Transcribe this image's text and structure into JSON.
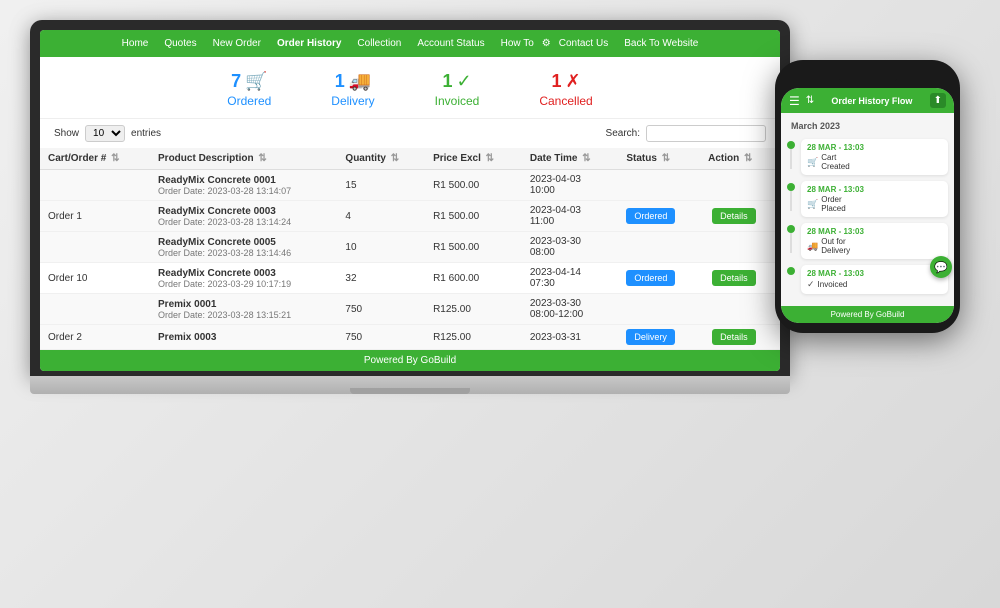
{
  "nav": {
    "items": [
      {
        "label": "Home",
        "active": false
      },
      {
        "label": "Quotes",
        "active": false
      },
      {
        "label": "New Order",
        "active": false
      },
      {
        "label": "Order History",
        "active": true
      },
      {
        "label": "Collection",
        "active": false
      },
      {
        "label": "Account Status",
        "active": false
      },
      {
        "label": "How To",
        "active": false
      },
      {
        "label": "Contact Us",
        "active": false
      },
      {
        "label": "Back To Website",
        "active": false
      }
    ]
  },
  "stats": {
    "ordered": {
      "count": "7",
      "label": "Ordered",
      "icon": "🛒"
    },
    "delivery": {
      "count": "1",
      "label": "Delivery",
      "icon": "🚚"
    },
    "invoiced": {
      "count": "1",
      "label": "Invoiced",
      "icon": "✓"
    },
    "cancelled": {
      "count": "1",
      "label": "Cancelled",
      "icon": "✗"
    }
  },
  "table_controls": {
    "show_label": "Show",
    "show_value": "10",
    "entries_label": "entries",
    "search_label": "Search:"
  },
  "table": {
    "columns": [
      "Cart/Order #",
      "Product Description",
      "Quantity",
      "Price Excl",
      "Date Time",
      "Status",
      "Action"
    ],
    "rows": [
      {
        "order": "Order 1",
        "product": "ReadyMix Concrete 0001",
        "order_date": "Order Date: 2023-03-28 13:14:07",
        "quantity": "15",
        "price": "R1 500.00",
        "datetime": "2023-04-03\n10:00",
        "status": "",
        "action": ""
      },
      {
        "order": "Order 1",
        "product": "ReadyMix Concrete 0003",
        "order_date": "Order Date: 2023-03-28 13:14:24",
        "quantity": "4",
        "price": "R1 500.00",
        "datetime": "2023-04-03\n11:00",
        "status": "Ordered",
        "action": "Details"
      },
      {
        "order": "Order 1",
        "product": "ReadyMix Concrete 0005",
        "order_date": "Order Date: 2023-03-28 13:14:46",
        "quantity": "10",
        "price": "R1 500.00",
        "datetime": "2023-03-30\n08:00",
        "status": "",
        "action": ""
      },
      {
        "order": "Order 10",
        "product": "ReadyMix Concrete 0003",
        "order_date": "Order Date: 2023-03-29 10:17:19",
        "quantity": "32",
        "price": "R1 600.00",
        "datetime": "2023-04-14\n07:30",
        "status": "Ordered",
        "action": "Details"
      },
      {
        "order": "Order 2",
        "product": "Premix 0001",
        "order_date": "Order Date: 2023-03-28 13:15:21",
        "quantity": "750",
        "price": "R125.00",
        "datetime": "2023-03-30\n08:00-12:00",
        "status": "",
        "action": ""
      },
      {
        "order": "Order 2",
        "product": "Premix 0003",
        "order_date": "",
        "quantity": "750",
        "price": "R125.00",
        "datetime": "2023-03-31",
        "status": "Delivery",
        "action": "Details"
      }
    ]
  },
  "footer": {
    "label": "Powered By GoBuild"
  },
  "phone": {
    "title": "Order History Flow",
    "month": "March 2023",
    "timeline": [
      {
        "time": "28 MAR - 13:03",
        "icon": "🛒",
        "text": "Cart\nCreated"
      },
      {
        "time": "28 MAR - 13:03",
        "icon": "🛒",
        "text": "Order\nPlaced"
      },
      {
        "time": "28 MAR - 13:03",
        "icon": "🚚",
        "text": "Out for\nDelivery"
      },
      {
        "time": "28 MAR - 13:03",
        "icon": "✓",
        "text": "Invoiced"
      }
    ],
    "footer": "Powered By GoBuild"
  }
}
